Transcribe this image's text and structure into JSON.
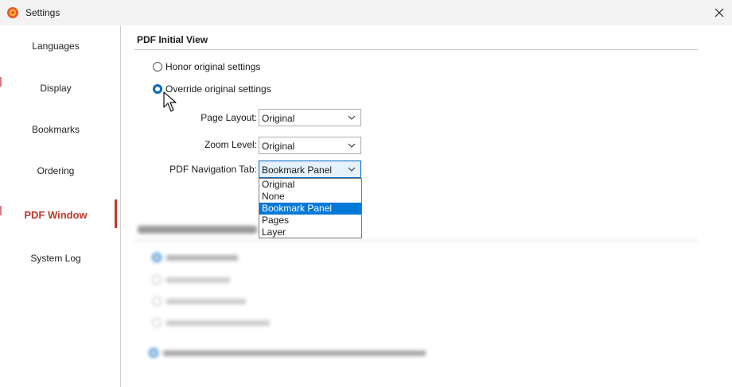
{
  "window": {
    "title": "Settings"
  },
  "sidebar": {
    "items": [
      {
        "label": "Languages"
      },
      {
        "label": "Display"
      },
      {
        "label": "Bookmarks"
      },
      {
        "label": "Ordering"
      },
      {
        "label": "PDF Window"
      },
      {
        "label": "System Log"
      }
    ],
    "active": "PDF Window"
  },
  "pdf_initial_view": {
    "title": "PDF Initial View",
    "radio_honor": "Honor original settings",
    "radio_override": "Override original settings",
    "selected_radio": "Override original settings",
    "page_layout": {
      "label": "Page Layout:",
      "value": "Original"
    },
    "zoom_level": {
      "label": "Zoom Level:",
      "value": "Original"
    },
    "navigation_tab": {
      "label": "PDF Navigation Tab:",
      "value": "Bookmark Panel",
      "options": [
        "Original",
        "None",
        "Bookmark Panel",
        "Pages",
        "Layer"
      ]
    }
  },
  "colors": {
    "accent": "#c0392b",
    "selection": "#0078d7",
    "radio": "#0067c0"
  },
  "icons": {
    "app": "app-logo-icon",
    "close": "close-icon",
    "chevron": "chevron-down-icon",
    "cursor": "mouse-pointer-icon"
  }
}
